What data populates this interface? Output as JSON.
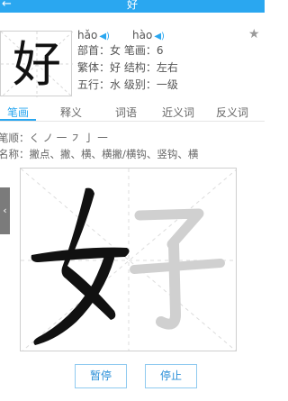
{
  "header": {
    "back_icon": "←",
    "title": "好"
  },
  "character": {
    "glyph": "好",
    "pinyin": [
      {
        "text": "hǎo",
        "speaker_icon": "speaker-icon"
      },
      {
        "text": "hào",
        "speaker_icon": "speaker-icon"
      }
    ],
    "speaker_glyph": "◀)",
    "favorite_icon": "★"
  },
  "info_lines": [
    "部首：女   笔画：6",
    "繁体：好   结构：左右",
    "五行：水   级别：一级"
  ],
  "tabs": [
    {
      "label": "笔画",
      "active": true
    },
    {
      "label": "释义",
      "active": false
    },
    {
      "label": "词语",
      "active": false
    },
    {
      "label": "近义词",
      "active": false
    },
    {
      "label": "反义词",
      "active": false
    }
  ],
  "stroke_detail": {
    "order_line": "笔顺：く ノ 一 ㇇ 亅 一",
    "names_line": "名称：撇点、撇、横、横撇/横钩、竖钩、横"
  },
  "side_handle_glyph": "‹",
  "buttons": {
    "pause": "暂停",
    "stop": "停止"
  },
  "colors": {
    "accent": "#2aa7f0",
    "stroke_done": "#111111",
    "stroke_pending": "#d0d0d0"
  }
}
